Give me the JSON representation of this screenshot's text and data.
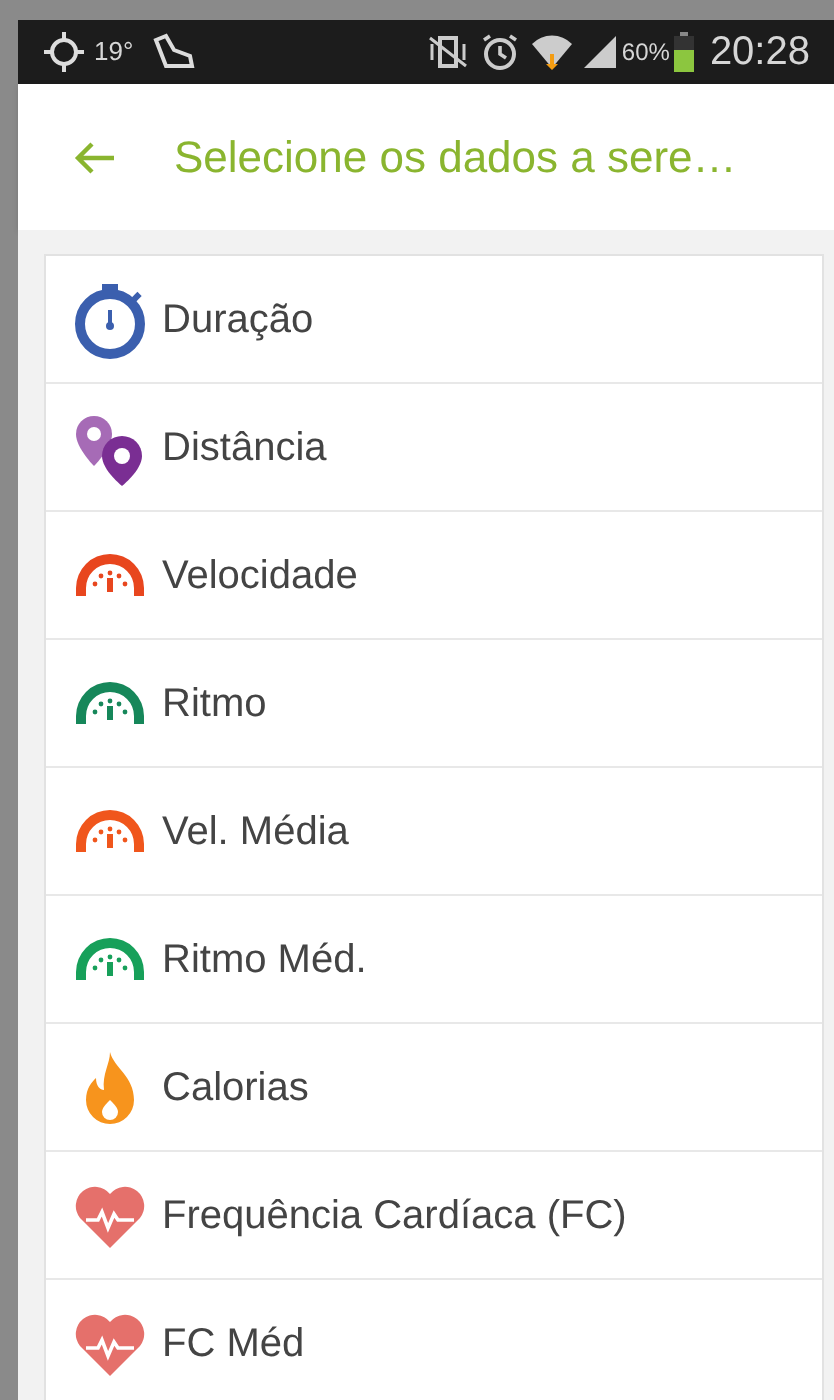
{
  "status_bar": {
    "temperature": "19°",
    "battery": "60%",
    "time": "20:28"
  },
  "header": {
    "title": "Selecione os dados a sere…"
  },
  "items": [
    {
      "kind": "stopwatch",
      "label": "Duração"
    },
    {
      "kind": "pins",
      "label": "Distância"
    },
    {
      "kind": "gauge",
      "color": "#e8461e",
      "label": "Velocidade"
    },
    {
      "kind": "gauge",
      "color": "#16875a",
      "label": "Ritmo"
    },
    {
      "kind": "gauge",
      "color": "#f0561c",
      "label": "Vel. Média"
    },
    {
      "kind": "gauge",
      "color": "#17a05a",
      "label": "Ritmo Méd."
    },
    {
      "kind": "flame",
      "label": "Calorias"
    },
    {
      "kind": "heart",
      "label": "Frequência Cardíaca (FC)"
    },
    {
      "kind": "heart",
      "label": "FC Méd"
    }
  ]
}
